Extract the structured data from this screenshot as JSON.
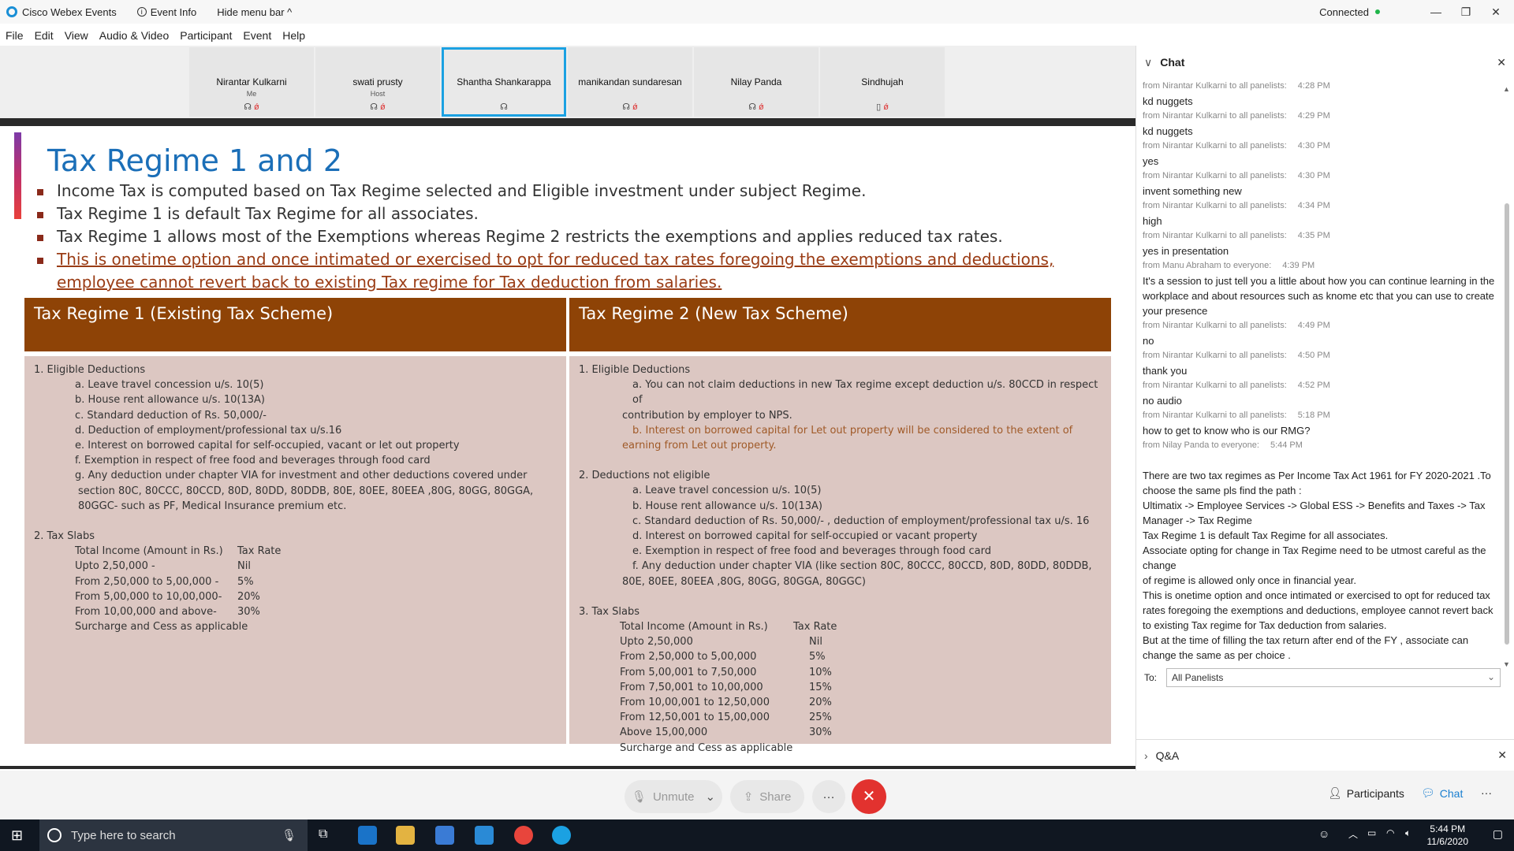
{
  "titlebar": {
    "app_name": "Cisco Webex Events",
    "event_info": "Event Info",
    "hide_menu": "Hide menu bar ^",
    "status": "Connected"
  },
  "menu": [
    "File",
    "Edit",
    "View",
    "Audio & Video",
    "Participant",
    "Event",
    "Help"
  ],
  "participants": [
    {
      "name": "Nirantar Kulkarni",
      "role": "Me"
    },
    {
      "name": "swati prusty",
      "role": "Host"
    },
    {
      "name": "Shantha Shankarappa",
      "role": ""
    },
    {
      "name": "manikandan sundaresan",
      "role": ""
    },
    {
      "name": "Nilay Panda",
      "role": ""
    },
    {
      "name": "Sindhujah",
      "role": ""
    }
  ],
  "slide": {
    "title": "Tax Regime 1 and 2",
    "bullets": [
      "Income Tax is computed based on Tax Regime selected and Eligible investment under subject Regime.",
      "Tax Regime 1 is default Tax Regime for all associates.",
      "Tax Regime 1 allows most of the Exemptions whereas Regime 2 restricts the exemptions and applies reduced tax rates.",
      "This is onetime option and once intimated or exercised to opt for reduced tax rates foregoing the exemptions and deductions, employee cannot revert back to existing Tax regime for Tax deduction from salaries."
    ],
    "col1_head": "Tax Regime 1 (Existing Tax Scheme)",
    "col2_head": "Tax Regime 2 (New Tax Scheme)",
    "col1": {
      "sec1": "1. Eligible Deductions",
      "items": [
        "a. Leave travel concession u/s. 10(5)",
        "b. House rent allowance u/s. 10(13A)",
        "c. Standard deduction of Rs. 50,000/-",
        "d. Deduction of employment/professional  tax u/s.16",
        "e. Interest on borrowed capital for self-occupied, vacant or let out property",
        "f.  Exemption in respect of free food and beverages through food card",
        "g. Any deduction under chapter VIA  for investment and other deductions covered under",
        "section 80C, 80CCC, 80CCD, 80D,  80DD, 80DDB, 80E, 80EE, 80EEA ,80G, 80GG, 80GGA,",
        "80GGC- such as PF, Medical Insurance premium etc."
      ],
      "sec2": "2. Tax Slabs",
      "slab_head": [
        "Total Income (Amount in Rs.)",
        "Tax Rate"
      ],
      "slabs": [
        [
          "Upto  2,50,000      -",
          "Nil"
        ],
        [
          "From 2,50,000 to 5,00,000 -",
          "5%"
        ],
        [
          "From 5,00,000 to 10,00,000-",
          "20%"
        ],
        [
          "From 10,00,000 and above-",
          "30%"
        ]
      ],
      "footer": "Surcharge and Cess as applicable"
    },
    "col2": {
      "sec1": "1. Eligible Deductions",
      "item_a": "a. You can not claim deductions in new Tax regime except deduction u/s. 80CCD in respect of",
      "item_a2": "contribution by employer to NPS.",
      "item_b": "b. Interest on borrowed capital for Let out property will be considered to the extent of",
      "item_b2": "earning from Let out property.",
      "sec2": "2. Deductions not eligible",
      "items": [
        "a. Leave travel concession u/s. 10(5)",
        "b. House rent allowance u/s. 10(13A)",
        "c. Standard deduction of Rs. 50,000/- , deduction of  employment/professional tax u/s. 16",
        "d. Interest on borrowed capital for self-occupied or vacant property",
        "e. Exemption in respect of free food and beverages through food card",
        "f. Any deduction under chapter VIA (like section 80C, 80CCC, 80CCD, 80D, 80DD, 80DDB,"
      ],
      "items_cont": "80E, 80EE, 80EEA ,80G, 80GG, 80GGA, 80GGC)",
      "sec3": "3. Tax Slabs",
      "slab_head": [
        "Total Income (Amount in Rs.)",
        "Tax Rate"
      ],
      "slabs": [
        [
          "Upto  2,50,000",
          "Nil"
        ],
        [
          "From  2,50,000 to 5,00,000",
          "5%"
        ],
        [
          "From  5,00,001 to 7,50,000",
          "10%"
        ],
        [
          "From  7,50,001 to 10,00,000",
          "15%"
        ],
        [
          "From  10,00,001 to 12,50,000",
          "20%"
        ],
        [
          "From  12,50,001 to 15,00,000",
          "25%"
        ],
        [
          "Above 15,00,000",
          "30%"
        ]
      ],
      "footer": "Surcharge and Cess as applicable"
    }
  },
  "chat": {
    "title": "Chat",
    "messages": [
      {
        "from": "from Nirantar Kulkarni to all panelists:",
        "time": "4:28 PM",
        "text": "kd nuggets"
      },
      {
        "from": "from Nirantar Kulkarni to all panelists:",
        "time": "4:29 PM",
        "text": "kd nuggets"
      },
      {
        "from": "from Nirantar Kulkarni to all panelists:",
        "time": "4:30 PM",
        "text": "yes"
      },
      {
        "from": "from Nirantar Kulkarni to all panelists:",
        "time": "4:30 PM",
        "text": "invent something new"
      },
      {
        "from": "from Nirantar Kulkarni to all panelists:",
        "time": "4:34 PM",
        "text": "high"
      },
      {
        "from": "from Nirantar Kulkarni to all panelists:",
        "time": "4:35 PM",
        "text": "yes in presentation"
      },
      {
        "from": "from Manu Abraham to everyone:",
        "time": "4:39 PM",
        "text": "It's a session to just tell you a little about how you can continue learning in the workplace and about resources such as knome etc that you can use to create your presence"
      },
      {
        "from": "from Nirantar Kulkarni to all panelists:",
        "time": "4:49 PM",
        "text": "no"
      },
      {
        "from": "from Nirantar Kulkarni to all panelists:",
        "time": "4:50 PM",
        "text": "thank you"
      },
      {
        "from": "from Nirantar Kulkarni to all panelists:",
        "time": "4:52 PM",
        "text": "no audio"
      },
      {
        "from": "from Nirantar Kulkarni to all panelists:",
        "time": "5:18 PM",
        "text": "how to get to know who is our RMG?"
      },
      {
        "from": "from Nilay Panda to everyone:",
        "time": "5:44 PM",
        "text": ""
      }
    ],
    "long_message": [
      "There are two  tax regimes as Per Income Tax Act 1961 for FY 2020-2021  .To choose the same pls find the path :",
      "Ultimatix -> Employee Services -> Global ESS -> Benefits and Taxes -> Tax Manager -> Tax Regime",
      "Tax Regime 1 is default Tax Regime for all associates.",
      "Associate opting for change in Tax Regime need to be utmost careful as the change",
      "of regime is allowed only once in financial year.",
      "This is onetime option and once intimated or exercised to opt for reduced tax rates foregoing the exemptions and deductions, employee cannot revert back to existing Tax regime for Tax deduction from salaries.",
      "But at the time of filling the tax return after end of the FY , associate can change the same as per choice ."
    ],
    "to_label": "To:",
    "to_value": "All Panelists",
    "qa_label": "Q&A"
  },
  "controls": {
    "unmute": "Unmute",
    "share": "Share",
    "more": "···",
    "participants": "Participants",
    "chat": "Chat"
  },
  "taskbar": {
    "search_placeholder": "Type here to search",
    "time": "5:44 PM",
    "date": "11/6/2020"
  },
  "colors": {
    "accent": "#1ba1e2",
    "table_head": "#8e4306",
    "table_body": "#dcc7c2",
    "end_call": "#e2322f",
    "title": "#1b6fb8"
  }
}
